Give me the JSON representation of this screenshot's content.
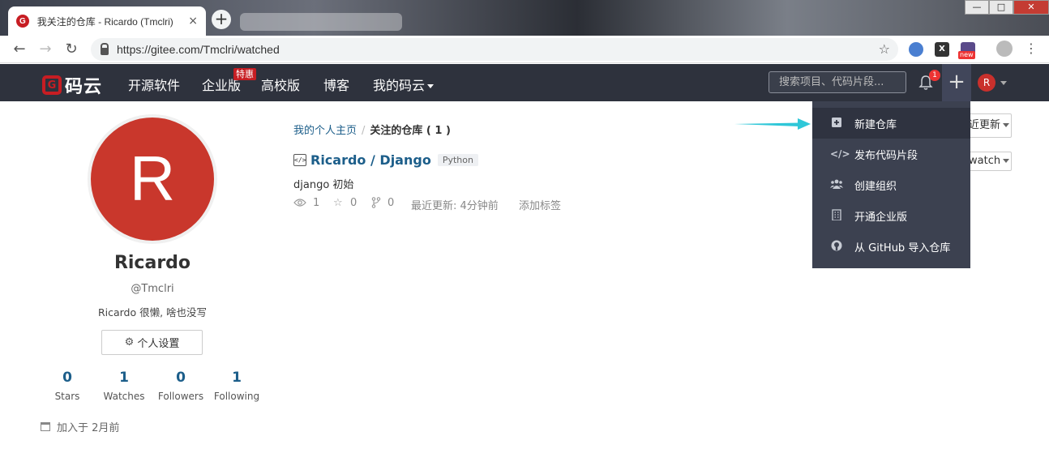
{
  "browser": {
    "tab_title": "我关注的仓库 - Ricardo (Tmclri)",
    "favicon_letter": "G",
    "tab_close": "×",
    "new_tab": "+",
    "url": "https://gitee.com/Tmclri/watched",
    "bookmark_icon": "star-icon",
    "ext_x": "X",
    "ext_new": "new",
    "win_min": "—",
    "win_max": "□",
    "win_close": "✕"
  },
  "navbar": {
    "logo_letter": "G",
    "logo_text": "码云",
    "items": [
      {
        "label": "开源软件"
      },
      {
        "label": "企业版"
      },
      {
        "label": "高校版"
      },
      {
        "label": "博客"
      },
      {
        "label": "我的码云"
      }
    ],
    "enterprise_badge": "特惠",
    "search_placeholder": "搜索项目、代码片段...",
    "notification_count": "1",
    "plus_label": "+",
    "user_initial": "R"
  },
  "profile": {
    "avatar_initial": "R",
    "name": "Ricardo",
    "handle": "@Tmclri",
    "bio": "Ricardo 很懒, 啥也没写",
    "settings_label": "个人设置",
    "stats": [
      {
        "value": "0",
        "label": "Stars"
      },
      {
        "value": "1",
        "label": "Watches"
      },
      {
        "value": "0",
        "label": "Followers"
      },
      {
        "value": "1",
        "label": "Following"
      }
    ],
    "joined": "加入于 2月前"
  },
  "main": {
    "breadcrumb_home": "我的个人主页",
    "breadcrumb_sep": "/",
    "breadcrumb_current": "关注的仓库 ( 1 )",
    "repo": {
      "icon_text": "</>",
      "name": "Ricardo / Django",
      "language": "Python",
      "description": "django 初始",
      "watches": "1",
      "stars": "0",
      "forks": "0",
      "updated": "最近更新: 4分钟前",
      "add_tag": "添加标签"
    },
    "sort_label": "近更新",
    "watch_filter_label": "watch"
  },
  "dropdown": {
    "items": [
      {
        "label": "新建仓库",
        "icon": "plus-square-icon"
      },
      {
        "label": "发布代码片段",
        "icon": "code-icon"
      },
      {
        "label": "创建组织",
        "icon": "users-icon"
      },
      {
        "label": "开通企业版",
        "icon": "building-icon"
      },
      {
        "label": "从 GitHub 导入仓库",
        "icon": "github-icon"
      }
    ]
  },
  "colors": {
    "navbar_bg": "#2e323d",
    "brand_red": "#c71d23",
    "link_blue": "#1c5e8a",
    "dropdown_bg": "#3c4150",
    "arrow_cyan": "#2fc7d8"
  }
}
